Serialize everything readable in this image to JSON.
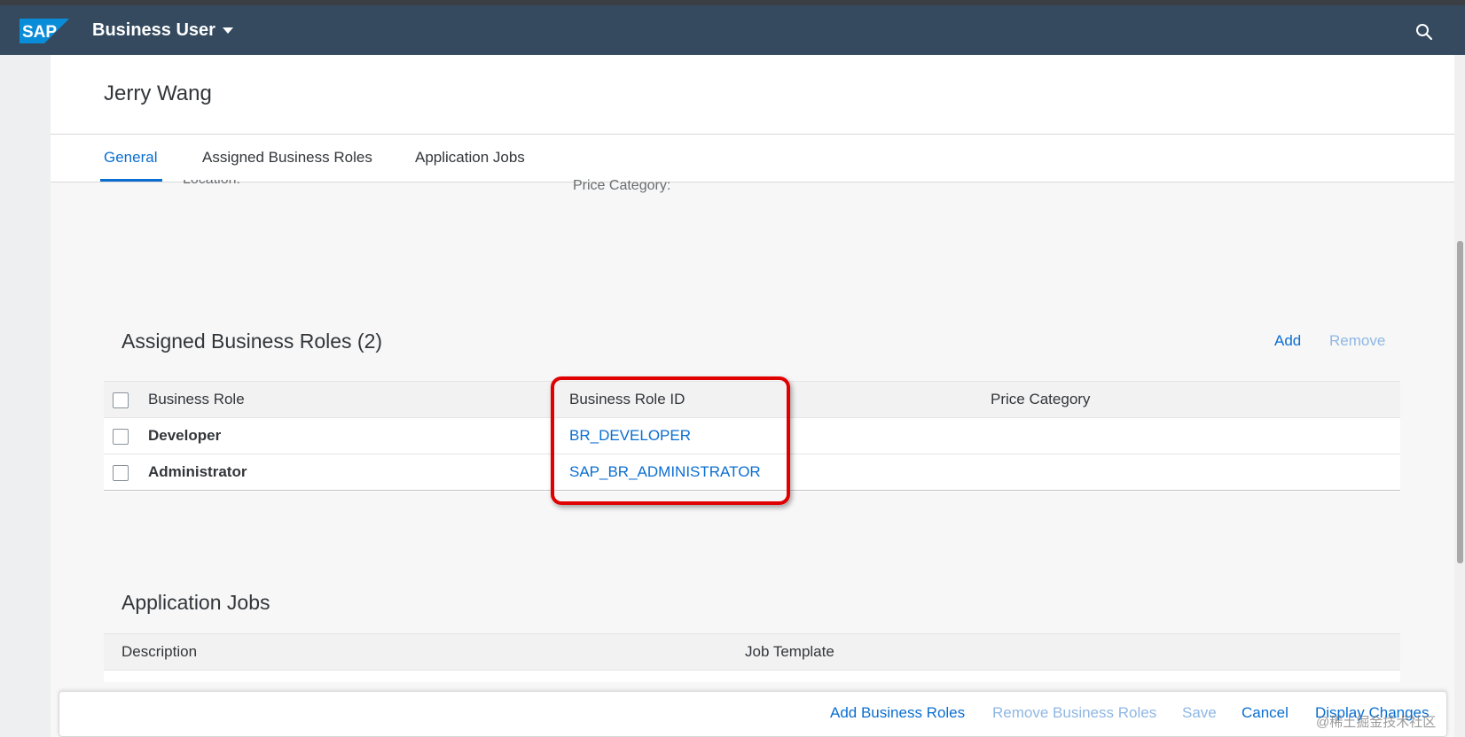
{
  "shell": {
    "logo_text": "SAP",
    "app_title": "Business User",
    "icons": {
      "search": "search-icon",
      "menu": "caret-down-icon"
    },
    "colors": {
      "shell": "#354a5f",
      "accent": "#0a6ed1",
      "highlight": "#e00000"
    }
  },
  "page": {
    "title": "Jerry Wang",
    "tabs": [
      {
        "label": "General",
        "active": true
      },
      {
        "label": "Assigned Business Roles",
        "active": false
      },
      {
        "label": "Application Jobs",
        "active": false
      }
    ],
    "fields": {
      "location_label": "Location:",
      "price_category_label": "Price Category:"
    }
  },
  "roles": {
    "title": "Assigned Business Roles (2)",
    "add": "Add",
    "remove": "Remove",
    "columns": [
      "Business Role",
      "Business Role ID",
      "Price Category"
    ],
    "rows": [
      {
        "role": "Developer",
        "id": "BR_DEVELOPER",
        "price_category": ""
      },
      {
        "role": "Administrator",
        "id": "SAP_BR_ADMINISTRATOR",
        "price_category": ""
      }
    ]
  },
  "jobs": {
    "title": "Application Jobs",
    "columns": [
      "Description",
      "Job Template"
    ]
  },
  "footer": {
    "add_business_roles": "Add Business Roles",
    "remove_business_roles": "Remove Business Roles",
    "save": "Save",
    "cancel": "Cancel",
    "display_changes": "Display Changes"
  },
  "watermark": "@稀土掘金技术社区"
}
